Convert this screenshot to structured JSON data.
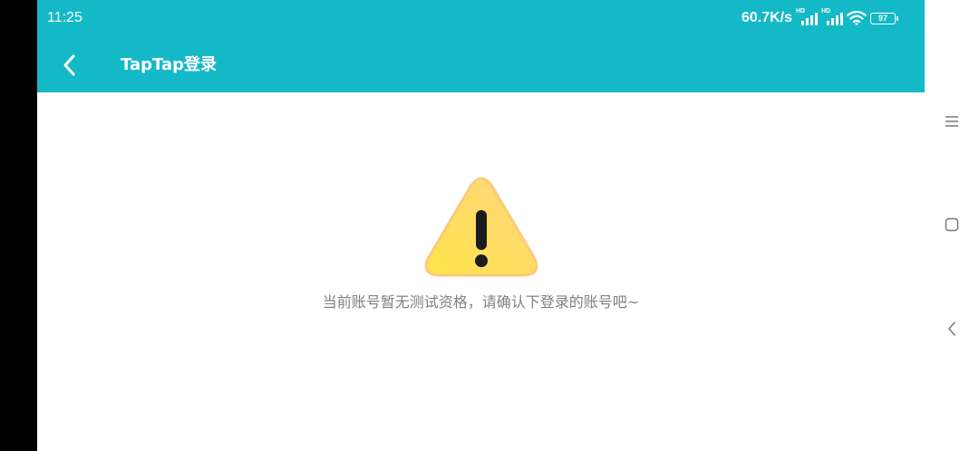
{
  "status_bar": {
    "time": "11:25",
    "network_speed": "60.7K/s",
    "signal_1_tag": "HD",
    "signal_2_tag": "HD",
    "wifi_icon": "wifi-icon",
    "battery_level": "97"
  },
  "header": {
    "back_icon": "chevron-left-icon",
    "title": "TapTap登录"
  },
  "content": {
    "icon": "warning-triangle-icon",
    "message": "当前账号暂无测试资格，请确认下登录的账号吧~"
  },
  "navigation": {
    "items": [
      {
        "icon": "menu-icon"
      },
      {
        "icon": "home-square-icon"
      },
      {
        "icon": "back-chevron-icon"
      }
    ]
  },
  "colors": {
    "header_bg": "#14B9C8",
    "message_text": "#808080",
    "warning_yellow": "#FFE54A",
    "warning_orange": "#FFD57E"
  }
}
